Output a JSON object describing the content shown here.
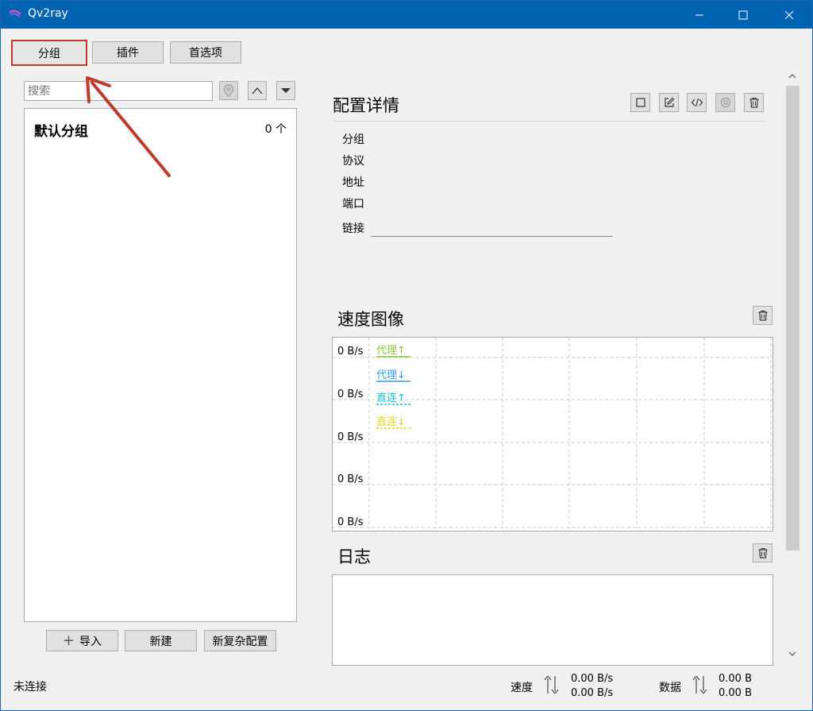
{
  "window": {
    "title": "Qv2ray"
  },
  "toolbar": {
    "groups_label": "分组",
    "plugins_label": "插件",
    "preferences_label": "首选项"
  },
  "search": {
    "placeholder": "搜索"
  },
  "groups": [
    {
      "name": "默认分组",
      "count": "0 个"
    }
  ],
  "group_actions": {
    "import_label": "导入",
    "new_label": "新建",
    "new_complex_label": "新复杂配置"
  },
  "details": {
    "title": "配置详情",
    "labels": {
      "group": "分组",
      "protocol": "协议",
      "address": "地址",
      "port": "端口",
      "link": "链接"
    }
  },
  "speed_chart": {
    "title": "速度图像",
    "chart_data": {
      "type": "line",
      "title": "速度图像",
      "y_tick_labels": [
        "0 B/s",
        "0 B/s",
        "0 B/s",
        "0 B/s",
        "0 B/s"
      ],
      "series": [
        {
          "name": "代理↑",
          "color": "#8cc63e",
          "values": []
        },
        {
          "name": "代理↓",
          "color": "#3399ff",
          "values": []
        },
        {
          "name": "直连↑",
          "color": "#19c3d6",
          "values": []
        },
        {
          "name": "直连↓",
          "color": "#e8d21e",
          "values": []
        }
      ],
      "grid": true,
      "legend_position": "top-left"
    }
  },
  "log": {
    "title": "日志"
  },
  "status": {
    "connection": "未连接",
    "speed_label": "速度",
    "speed_up": "0.00 B/s",
    "speed_down": "0.00 B/s",
    "data_label": "数据",
    "data_up": "0.00 B",
    "data_down": "0.00 B"
  },
  "colors": {
    "titlebar": "#0063b1",
    "focus_border": "#c0392b",
    "annotation_arrow": "#c0392b"
  }
}
